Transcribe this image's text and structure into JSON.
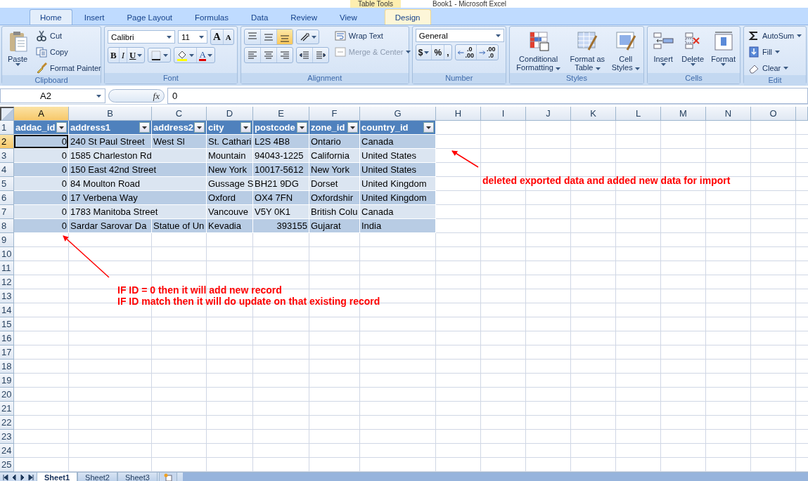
{
  "window": {
    "title": "Book1 - Microsoft Excel",
    "context_label": "Table Tools"
  },
  "ribbon": {
    "tabs": [
      {
        "label": "Home",
        "selected": true
      },
      {
        "label": "Insert",
        "selected": false
      },
      {
        "label": "Page Layout",
        "selected": false
      },
      {
        "label": "Formulas",
        "selected": false
      },
      {
        "label": "Data",
        "selected": false
      },
      {
        "label": "Review",
        "selected": false
      },
      {
        "label": "View",
        "selected": false
      },
      {
        "label": "Design",
        "selected": false,
        "kind": "contextual"
      }
    ],
    "groups": [
      {
        "label": "Clipboard",
        "items": [
          {
            "kind": "large",
            "label": "Paste"
          },
          {
            "kind": "small",
            "label": "Cut"
          },
          {
            "kind": "small",
            "label": "Copy"
          },
          {
            "kind": "small",
            "label": "Format Painter"
          }
        ]
      },
      {
        "label": "Font",
        "items": [
          {
            "kind": "combo",
            "value": "Calibri"
          },
          {
            "kind": "combo",
            "value": "11"
          },
          {
            "kind": "button",
            "label": "A"
          },
          {
            "kind": "button",
            "label": "A"
          },
          {
            "kind": "button",
            "label": "B"
          },
          {
            "kind": "button",
            "label": "I"
          },
          {
            "kind": "button",
            "label": "U"
          },
          {
            "kind": "button"
          },
          {
            "kind": "button"
          },
          {
            "kind": "button",
            "label": "A"
          }
        ]
      },
      {
        "label": "Alignment",
        "items": [
          {
            "kind": "button",
            "selected": false
          },
          {
            "kind": "button",
            "selected": false
          },
          {
            "kind": "button",
            "selected": true
          },
          {
            "kind": "button"
          },
          {
            "kind": "button",
            "selected": false
          },
          {
            "kind": "button",
            "selected": false
          },
          {
            "kind": "button",
            "selected": false
          },
          {
            "kind": "button"
          },
          {
            "kind": "button"
          },
          {
            "kind": "small",
            "label": "Wrap Text",
            "disabled": false
          },
          {
            "kind": "small",
            "label": "Merge & Center",
            "disabled": true
          }
        ]
      },
      {
        "label": "Number",
        "items": [
          {
            "kind": "combo",
            "value": "General"
          },
          {
            "kind": "button",
            "label": "$"
          },
          {
            "kind": "button",
            "label": "%"
          },
          {
            "kind": "button",
            "label": ","
          },
          {
            "kind": "decimal",
            "top": ".0",
            "bottom": ".00"
          },
          {
            "kind": "decimal",
            "top": ".00",
            "bottom": ".0"
          }
        ]
      },
      {
        "label": "Styles",
        "items": [
          {
            "kind": "large",
            "label": "Conditional Formatting"
          },
          {
            "kind": "large",
            "label": "Format as Table"
          },
          {
            "kind": "large",
            "label": "Cell Styles"
          }
        ]
      },
      {
        "label": "Cells",
        "items": [
          {
            "kind": "large",
            "label": "Insert"
          },
          {
            "kind": "large",
            "label": "Delete"
          },
          {
            "kind": "large",
            "label": "Format"
          }
        ]
      },
      {
        "label": "Edit",
        "items": [
          {
            "kind": "small",
            "label": "AutoSum"
          },
          {
            "kind": "small",
            "label": "Fill"
          },
          {
            "kind": "small",
            "label": "Clear"
          }
        ]
      }
    ]
  },
  "formula_bar": {
    "name_box": "A2",
    "function_label": "fx",
    "formula": "0"
  },
  "sheet": {
    "columns": [
      {
        "label": "A",
        "selected": true
      },
      {
        "label": "B",
        "selected": false
      },
      {
        "label": "C",
        "selected": false
      },
      {
        "label": "D",
        "selected": false
      },
      {
        "label": "E",
        "selected": false
      },
      {
        "label": "F",
        "selected": false
      },
      {
        "label": "G",
        "selected": false
      },
      {
        "label": "H",
        "selected": false
      },
      {
        "label": "I",
        "selected": false
      },
      {
        "label": "J",
        "selected": false
      },
      {
        "label": "K",
        "selected": false
      },
      {
        "label": "L",
        "selected": false
      },
      {
        "label": "M",
        "selected": false
      },
      {
        "label": "N",
        "selected": false
      },
      {
        "label": "O",
        "selected": false
      }
    ],
    "rows": [
      {
        "label": "1",
        "selected": false,
        "cells": [
          {
            "kind": "header",
            "text": "addac_id"
          },
          {
            "kind": "header",
            "text": "address1"
          },
          {
            "kind": "header",
            "text": "address2"
          },
          {
            "kind": "header",
            "text": "city"
          },
          {
            "kind": "header",
            "text": "postcode"
          },
          {
            "kind": "header",
            "text": "zone_id"
          },
          {
            "kind": "header",
            "text": "country_id"
          }
        ]
      },
      {
        "label": "2",
        "selected": true,
        "cells": [
          {
            "kind": "number",
            "text": "0"
          },
          {
            "kind": "text",
            "text": "240 St Paul Street"
          },
          {
            "kind": "text",
            "text": "West Sl"
          },
          {
            "kind": "text",
            "text": "St. Cathari"
          },
          {
            "kind": "text",
            "text": "L2S 4B8"
          },
          {
            "kind": "text",
            "text": "Ontario"
          },
          {
            "kind": "text",
            "text": "Canada"
          }
        ]
      },
      {
        "label": "3",
        "selected": false,
        "cells": [
          {
            "kind": "number",
            "text": "0"
          },
          {
            "kind": "text",
            "text": "1585 Charleston Rd"
          },
          null,
          {
            "kind": "text",
            "text": "Mountain"
          },
          {
            "kind": "text",
            "text": "94043-1225"
          },
          {
            "kind": "text",
            "text": "California"
          },
          {
            "kind": "text",
            "text": "United States"
          }
        ]
      },
      {
        "label": "4",
        "selected": false,
        "cells": [
          {
            "kind": "number",
            "text": "0"
          },
          {
            "kind": "text",
            "text": "150 East 42nd Street"
          },
          null,
          {
            "kind": "text",
            "text": "New York"
          },
          {
            "kind": "text",
            "text": "10017-5612"
          },
          {
            "kind": "text",
            "text": "New York"
          },
          {
            "kind": "text",
            "text": "United States"
          }
        ]
      },
      {
        "label": "5",
        "selected": false,
        "cells": [
          {
            "kind": "number",
            "text": "0"
          },
          {
            "kind": "text",
            "text": "84 Moulton Road"
          },
          null,
          {
            "kind": "text",
            "text": "Gussage S"
          },
          {
            "kind": "text",
            "text": "BH21 9DG"
          },
          {
            "kind": "text",
            "text": "Dorset"
          },
          {
            "kind": "text",
            "text": "United Kingdom"
          }
        ]
      },
      {
        "label": "6",
        "selected": false,
        "cells": [
          {
            "kind": "number",
            "text": "0"
          },
          {
            "kind": "text",
            "text": "17 Verbena Way"
          },
          null,
          {
            "kind": "text",
            "text": "Oxford"
          },
          {
            "kind": "text",
            "text": "OX4 7FN"
          },
          {
            "kind": "text",
            "text": "Oxfordshir"
          },
          {
            "kind": "text",
            "text": "United Kingdom"
          }
        ]
      },
      {
        "label": "7",
        "selected": false,
        "cells": [
          {
            "kind": "number",
            "text": "0"
          },
          {
            "kind": "text",
            "text": "1783 Manitoba Street"
          },
          null,
          {
            "kind": "text",
            "text": "Vancouve"
          },
          {
            "kind": "text",
            "text": "V5Y 0K1"
          },
          {
            "kind": "text",
            "text": "British Colu"
          },
          {
            "kind": "text",
            "text": "Canada"
          }
        ]
      },
      {
        "label": "8",
        "selected": false,
        "cells": [
          {
            "kind": "number",
            "text": "0"
          },
          {
            "kind": "text",
            "text": "Sardar Sarovar Da"
          },
          {
            "kind": "text",
            "text": "Statue of Un"
          },
          {
            "kind": "text",
            "text": "Kevadia"
          },
          {
            "kind": "number",
            "text": "393155"
          },
          {
            "kind": "text",
            "text": "Gujarat"
          },
          {
            "kind": "text",
            "text": "India"
          }
        ]
      },
      {
        "label": "9",
        "selected": false
      },
      {
        "label": "10",
        "selected": false
      },
      {
        "label": "11",
        "selected": false
      },
      {
        "label": "12",
        "selected": false
      },
      {
        "label": "13",
        "selected": false
      },
      {
        "label": "14",
        "selected": false
      },
      {
        "label": "15",
        "selected": false
      },
      {
        "label": "16",
        "selected": false
      },
      {
        "label": "17",
        "selected": false
      },
      {
        "label": "18",
        "selected": false
      },
      {
        "label": "19",
        "selected": false
      },
      {
        "label": "20",
        "selected": false
      },
      {
        "label": "21",
        "selected": false
      },
      {
        "label": "22",
        "selected": false
      },
      {
        "label": "23",
        "selected": false
      },
      {
        "label": "24",
        "selected": false
      },
      {
        "label": "25",
        "selected": false
      }
    ]
  },
  "annotations": [
    {
      "lines": [
        "deleted exported data and added new data for import"
      ]
    },
    {
      "lines": [
        "IF ID = 0 then it will add new record",
        "IF ID match then it will do update on that existing record"
      ]
    }
  ],
  "sheet_tabs": [
    {
      "label": "Sheet1",
      "selected": true
    },
    {
      "label": "Sheet2",
      "selected": false
    },
    {
      "label": "Sheet3",
      "selected": false
    }
  ]
}
